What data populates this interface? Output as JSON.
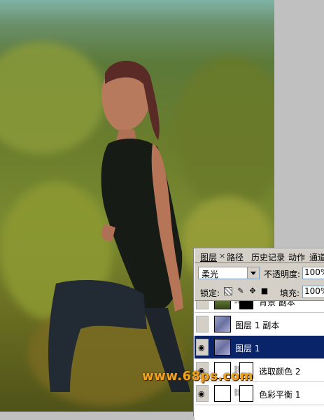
{
  "panel": {
    "tabs": [
      "图层",
      "路径",
      "历史记录",
      "动作",
      "通道"
    ],
    "close_glyph": "×",
    "blend_mode": "柔光",
    "opacity_label": "不透明度:",
    "opacity_value": "100%",
    "lock_label": "锁定:",
    "fill_label": "填充:",
    "fill_value": "100%",
    "layers": [
      {
        "name": "背景 副本",
        "icon": "photo-thumbnail",
        "selected": false
      },
      {
        "name": "图层 1 副本",
        "icon": "layer-thumbnail",
        "selected": false
      },
      {
        "name": "图层 1",
        "icon": "layer-thumbnail",
        "selected": true
      },
      {
        "name": "选取颜色 2",
        "icon": "adjustment-thumbnail",
        "selected": false
      },
      {
        "name": "色彩平衡 1",
        "icon": "adjustment-thumbnail",
        "selected": false
      }
    ]
  },
  "watermark": "www.68ps.com",
  "colors": {
    "selection": "#0a246a",
    "panel": "#d4d0c8",
    "watermark": "#f3a21b"
  }
}
